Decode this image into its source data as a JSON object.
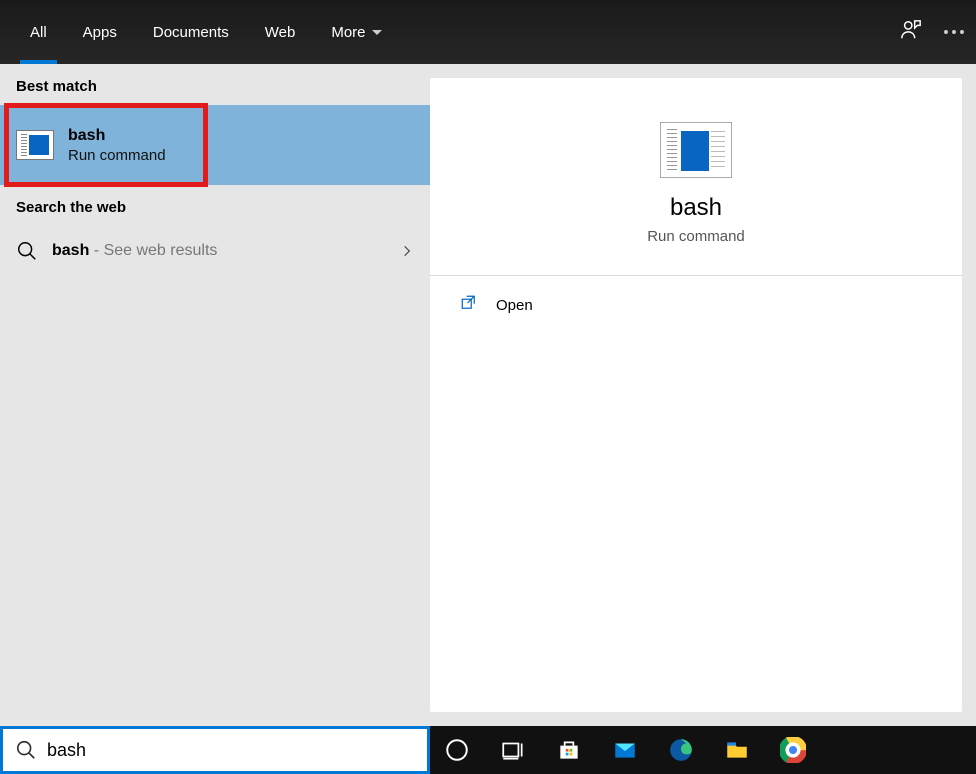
{
  "topbar": {
    "tabs": [
      "All",
      "Apps",
      "Documents",
      "Web",
      "More"
    ],
    "active_index": 0
  },
  "left": {
    "best_match_label": "Best match",
    "best_match": {
      "title": "bash",
      "subtitle": "Run command"
    },
    "search_web_label": "Search the web",
    "web_result": {
      "query": "bash",
      "suffix": " - See web results"
    }
  },
  "detail": {
    "title": "bash",
    "subtitle": "Run command",
    "actions": [
      {
        "label": "Open"
      }
    ]
  },
  "search": {
    "value": "bash"
  }
}
